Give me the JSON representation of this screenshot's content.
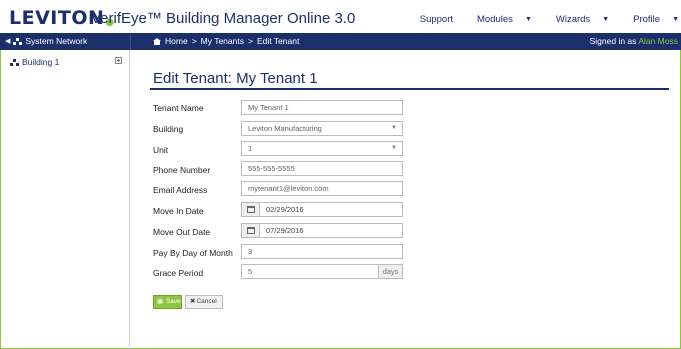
{
  "header": {
    "logo_text": "LEVITON",
    "app_title": "VerifEye™ Building Manager Online 3.0",
    "nav": {
      "support": "Support",
      "modules": "Modules",
      "wizards": "Wizards",
      "profile": "Profile"
    }
  },
  "navbar": {
    "system_network": "System Network",
    "breadcrumb": [
      "Home",
      "My Tenants",
      "Edit Tenant"
    ],
    "signed_in_prefix": "Signed in as",
    "signed_in_user": "Alan Moss"
  },
  "sidebar": {
    "items": [
      {
        "label": "Building 1"
      }
    ]
  },
  "form": {
    "title": "Edit Tenant: My Tenant 1",
    "tenant_name": {
      "label": "Tenant Name",
      "value": "My Tenant 1"
    },
    "building": {
      "label": "Building",
      "value": "Leviton Manufacturing"
    },
    "unit": {
      "label": "Unit",
      "value": "1"
    },
    "phone": {
      "label": "Phone Number",
      "value": "555-555-5555"
    },
    "email": {
      "label": "Email Address",
      "value": "mytenant1@leviton.com"
    },
    "move_in": {
      "label": "Move In Date",
      "value": "02/29/2016"
    },
    "move_out": {
      "label": "Move Out Date",
      "value": "07/29/2016"
    },
    "pay_day": {
      "label": "Pay By Day of Month",
      "value": "3"
    },
    "grace": {
      "label": "Grace Period",
      "value": "5",
      "unit": "days"
    },
    "save_label": "Save",
    "cancel_label": "Cancel"
  },
  "colors": {
    "navy": "#1b2f6b",
    "green": "#8dc63f"
  }
}
